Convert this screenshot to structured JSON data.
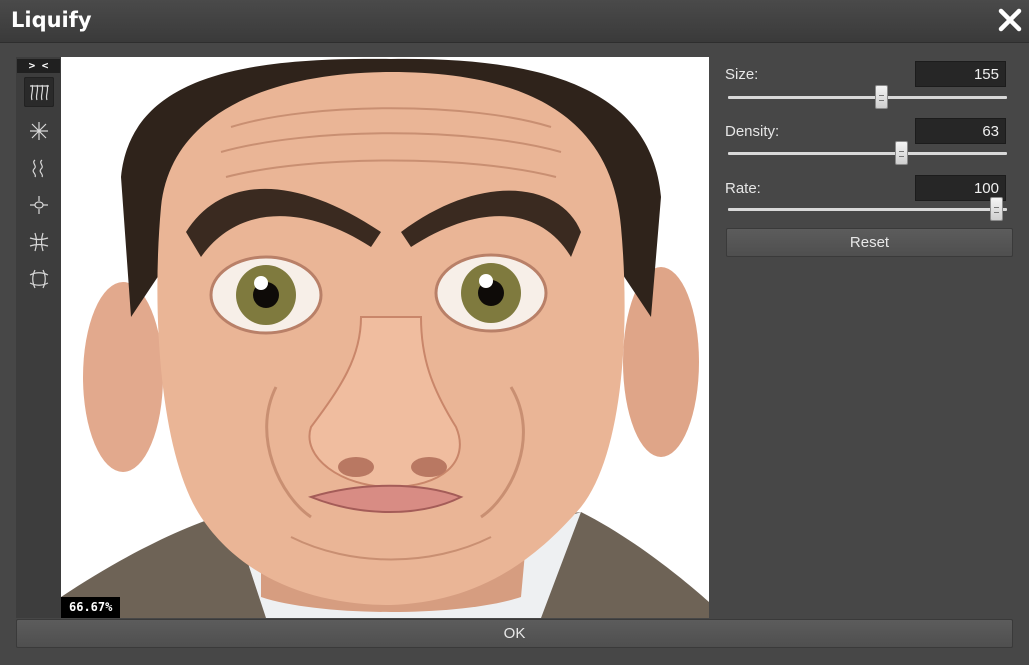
{
  "window": {
    "title": "Liquify",
    "close_icon": "close-icon"
  },
  "toolbar": {
    "collapse_label": "> <",
    "tools": [
      {
        "name": "forward-warp-icon",
        "active": true
      },
      {
        "name": "pinch-icon",
        "active": false
      },
      {
        "name": "twirl-icon",
        "active": false
      },
      {
        "name": "swirl-icon",
        "active": false
      },
      {
        "name": "pucker-icon",
        "active": false
      },
      {
        "name": "reconstruct-icon",
        "active": false
      }
    ]
  },
  "canvas": {
    "image": "edited portrait photo",
    "zoom_label": "66.67%"
  },
  "controls": {
    "size": {
      "label": "Size:",
      "value": "155",
      "level": 0.55
    },
    "density": {
      "label": "Density:",
      "value": "63",
      "level": 0.62
    },
    "rate": {
      "label": "Rate:",
      "value": "100",
      "level": 0.96
    }
  },
  "buttons": {
    "reset_label": "Reset",
    "ok_label": "OK"
  },
  "colors": {
    "background": "#474747",
    "titlebar": "#3e3e3e",
    "field": "#262626",
    "track": "#d9d9d9"
  }
}
